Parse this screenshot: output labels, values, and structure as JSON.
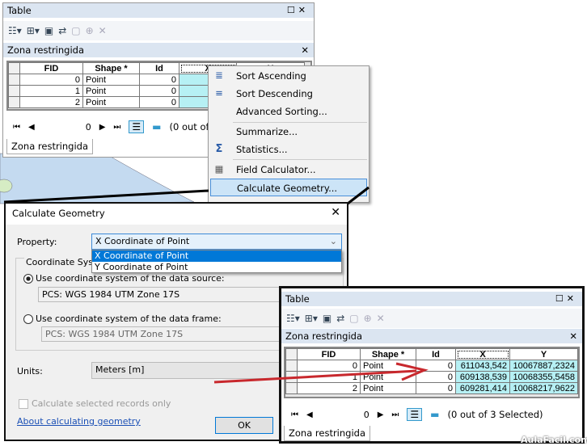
{
  "table1": {
    "title": "Table",
    "layer": "Zona restringida",
    "columns": [
      "FID",
      "Shape *",
      "Id",
      "X",
      "Y"
    ],
    "rows": [
      [
        "0",
        "Point",
        "0"
      ],
      [
        "1",
        "Point",
        "0"
      ],
      [
        "2",
        "Point",
        "0"
      ]
    ],
    "nav_value": "0",
    "status": "(0 out of 3 Selected)",
    "tab": "Zona restringida"
  },
  "context_menu": {
    "items": [
      {
        "label": "Sort Ascending",
        "icon": "sort-ascending-icon"
      },
      {
        "label": "Sort Descending",
        "icon": "sort-descending-icon"
      },
      {
        "label": "Advanced Sorting..."
      },
      {
        "label": "Summarize..."
      },
      {
        "label": "Statistics...",
        "icon": "sigma-icon"
      },
      {
        "label": "Field Calculator...",
        "icon": "calculator-icon"
      },
      {
        "label": "Calculate Geometry...",
        "highlighted": true
      }
    ]
  },
  "dialog": {
    "title": "Calculate Geometry",
    "property_label": "Property:",
    "property_value": "X Coordinate of Point",
    "options": [
      "X Coordinate of Point",
      "Y Coordinate of Point"
    ],
    "group_label": "Coordinate Syste",
    "radio1": "Use coordinate system of the data source:",
    "radio1_value": "PCS: WGS 1984 UTM Zone 17S",
    "radio2": "Use coordinate system of the data frame:",
    "radio2_value": "PCS: WGS 1984 UTM Zone 17S",
    "units_label": "Units:",
    "units_value": "Meters [m]",
    "checkbox": "Calculate selected records only",
    "link": "About calculating geometry",
    "ok": "OK"
  },
  "table2": {
    "title": "Table",
    "layer": "Zona restringida",
    "columns": [
      "FID",
      "Shape *",
      "Id",
      "X",
      "Y"
    ],
    "rows": [
      [
        "0",
        "Point",
        "0",
        "611043,542",
        "10067887,2324"
      ],
      [
        "1",
        "Point",
        "0",
        "609138,539",
        "10068355,5458"
      ],
      [
        "2",
        "Point",
        "0",
        "609281,414",
        "10068217,9622"
      ]
    ],
    "nav_value": "0",
    "status": "(0 out of 3 Selected)",
    "tab": "Zona restringida"
  },
  "watermark": "AulaFacil.com",
  "colors": {
    "title_bar": "#dbe5f1",
    "highlight": "#0078d7",
    "cell_fill": "#b6f0f4",
    "arrow": "#c8282d"
  }
}
